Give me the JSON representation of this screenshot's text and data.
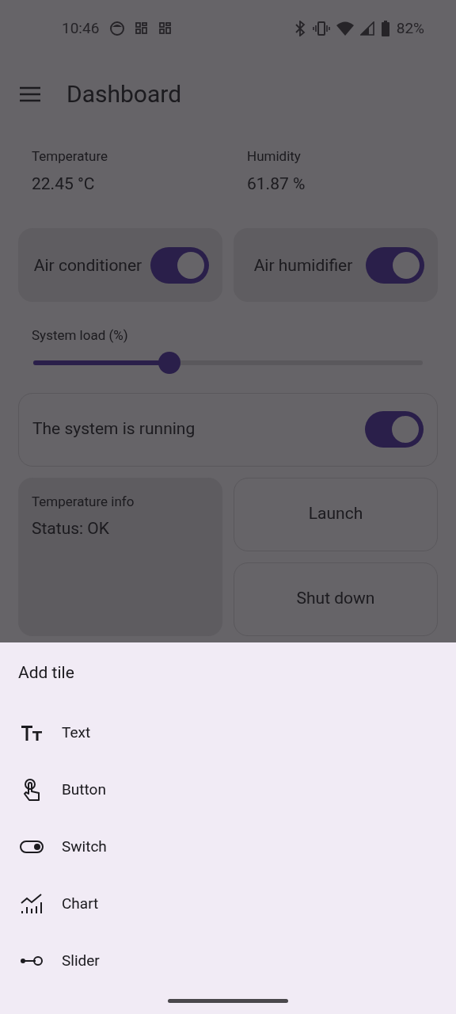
{
  "status_bar": {
    "time": "10:46",
    "battery": "82%"
  },
  "app_bar": {
    "title": "Dashboard"
  },
  "sensors": [
    {
      "label": "Temperature",
      "value": "22.45 °C"
    },
    {
      "label": "Humidity",
      "value": "61.87 %"
    }
  ],
  "toggle_tiles": [
    {
      "label": "Air conditioner",
      "on": true
    },
    {
      "label": "Air humidifier",
      "on": true
    }
  ],
  "slider": {
    "label": "System load (%)",
    "level": 0.35
  },
  "system_switch": {
    "label": "The system is running",
    "on": true
  },
  "info_tile": {
    "title": "Temperature info",
    "text": "Status: OK"
  },
  "buttons": [
    "Launch",
    "Shut down"
  ],
  "sheet": {
    "title": "Add tile",
    "items": [
      {
        "kind": "text",
        "label": "Text"
      },
      {
        "kind": "button",
        "label": "Button"
      },
      {
        "kind": "switch",
        "label": "Switch"
      },
      {
        "kind": "chart",
        "label": "Chart"
      },
      {
        "kind": "slider",
        "label": "Slider"
      }
    ]
  }
}
